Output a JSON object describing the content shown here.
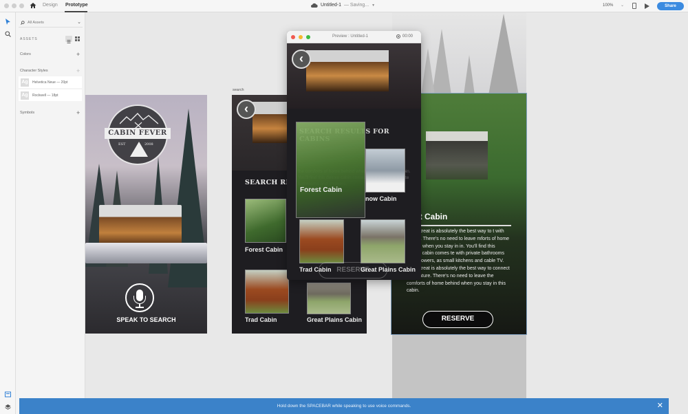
{
  "window": {
    "tabs": [
      {
        "label": "Design",
        "active": false
      },
      {
        "label": "Prototype",
        "active": true
      }
    ],
    "document_title": "Untitled-1",
    "status": "— Saving...",
    "zoom_level": "100%",
    "share_label": "Share"
  },
  "assets_panel": {
    "filter_label": "All Assets",
    "heading": "ASSETS",
    "sections": {
      "colors": "Colors",
      "character_styles": "Character Styles",
      "symbols": "Symbols"
    },
    "character_styles": [
      {
        "preview": "Ag",
        "label": "Helvetica Neue — 20pt"
      },
      {
        "preview": "Ag",
        "label": "Rockwell — 18pt"
      }
    ]
  },
  "artboards": {
    "home": {
      "logo": {
        "name": "CABIN FEVER",
        "est": "EST",
        "year": "2008"
      },
      "speak_label": "SPEAK TO SEARCH"
    },
    "search": {
      "label": "search",
      "heading": "SEARCH RESULTS",
      "heading_visible": "SEARCH RE",
      "results": [
        {
          "name": "Forest Cabin"
        },
        {
          "name": "Trad Cabin"
        },
        {
          "name": "Great Plains Cabin"
        }
      ]
    },
    "detail": {
      "title": "st Cabin",
      "body": "rest retreat is absolutely the best way to t with nature. There's no need to leave mforts of home behind when you stay in in. You'll find this deluxe cabin comes te with private bathrooms and showers, as small kitchens and cable TV. rest retreat is absolutely the best way to connect with nature. There's no need to leave the comforts of home behind when you stay in this cabin.",
      "reserve_label": "RESERVE"
    }
  },
  "preview_window": {
    "title": "Preview : Untitled-1",
    "timer": "00:00",
    "heading": "SEARCH RESULTS FOR CABINS",
    "results": [
      {
        "name": "Forest Cabin"
      },
      {
        "name": "now Cabin"
      },
      {
        "name": "Trad Cabin"
      },
      {
        "name": "Great Plains Cabin"
      }
    ],
    "ghost_text": "the comforts of home behind when you stay in this cabin. You'll find this deluxe cabin comes complete with private bathrooms and showers,",
    "ghost_reserve": "RESERVE"
  },
  "notification": {
    "message": "Hold down the SPACEBAR while speaking to use voice commands."
  }
}
